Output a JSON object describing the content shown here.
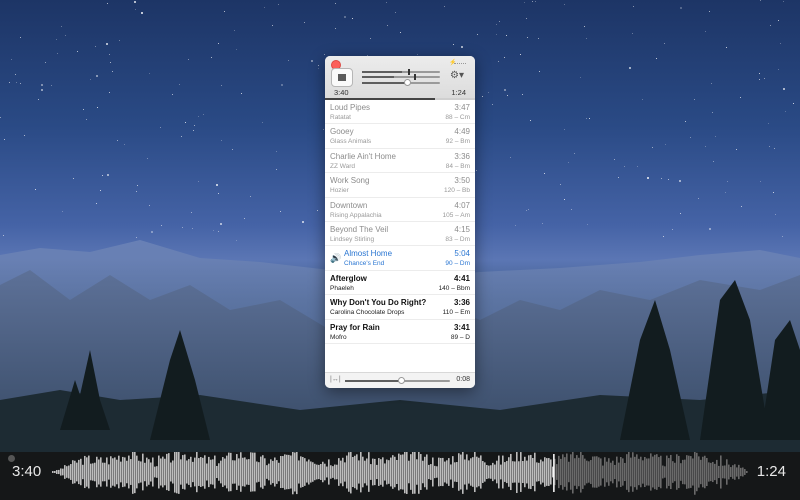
{
  "player": {
    "elapsed": "3:40",
    "remaining": "1:24",
    "track_progress": 0.73,
    "volume": 0.58,
    "settings_icon": "gear-icon",
    "stop_icon": "stop-icon"
  },
  "playlist": [
    {
      "title": "Loud Pipes",
      "artist": "Ratatat",
      "duration": "3:47",
      "key": "88 – Cm",
      "state": "played"
    },
    {
      "title": "Gooey",
      "artist": "Glass Animals",
      "duration": "4:49",
      "key": "92 – Bm",
      "state": "played"
    },
    {
      "title": "Charlie Ain't Home",
      "artist": "ZZ Ward",
      "duration": "3:36",
      "key": "84 – Bm",
      "state": "played"
    },
    {
      "title": "Work Song",
      "artist": "Hozier",
      "duration": "3:50",
      "key": "120 – Bb",
      "state": "played"
    },
    {
      "title": "Downtown",
      "artist": "Rising Appalachia",
      "duration": "4:07",
      "key": "105 – Am",
      "state": "played"
    },
    {
      "title": "Beyond The Veil",
      "artist": "Lindsey Stirling",
      "duration": "4:15",
      "key": "83 – Dm",
      "state": "played"
    },
    {
      "title": "Almost Home",
      "artist": "Chance's End",
      "duration": "5:04",
      "key": "90 – Dm",
      "state": "current"
    },
    {
      "title": "Afterglow",
      "artist": "Phaeleh",
      "duration": "4:41",
      "key": "140 – Bbm",
      "state": "upcoming"
    },
    {
      "title": "Why Don't You Do Right?",
      "artist": "Carolina Chocolate Drops",
      "duration": "3:36",
      "key": "110 – Em",
      "state": "upcoming"
    },
    {
      "title": "Pray for Rain",
      "artist": "Mofro",
      "duration": "3:41",
      "key": "89 – D",
      "state": "upcoming"
    }
  ],
  "bottom": {
    "crossfade": "0:08",
    "crossfade_level": 0.53,
    "fit_icon": "fit-width-icon"
  },
  "waveform": {
    "elapsed": "3:40",
    "remaining": "1:24",
    "progress": 0.72
  },
  "colors": {
    "accent": "#2a76d2",
    "close": "#fc605b"
  }
}
